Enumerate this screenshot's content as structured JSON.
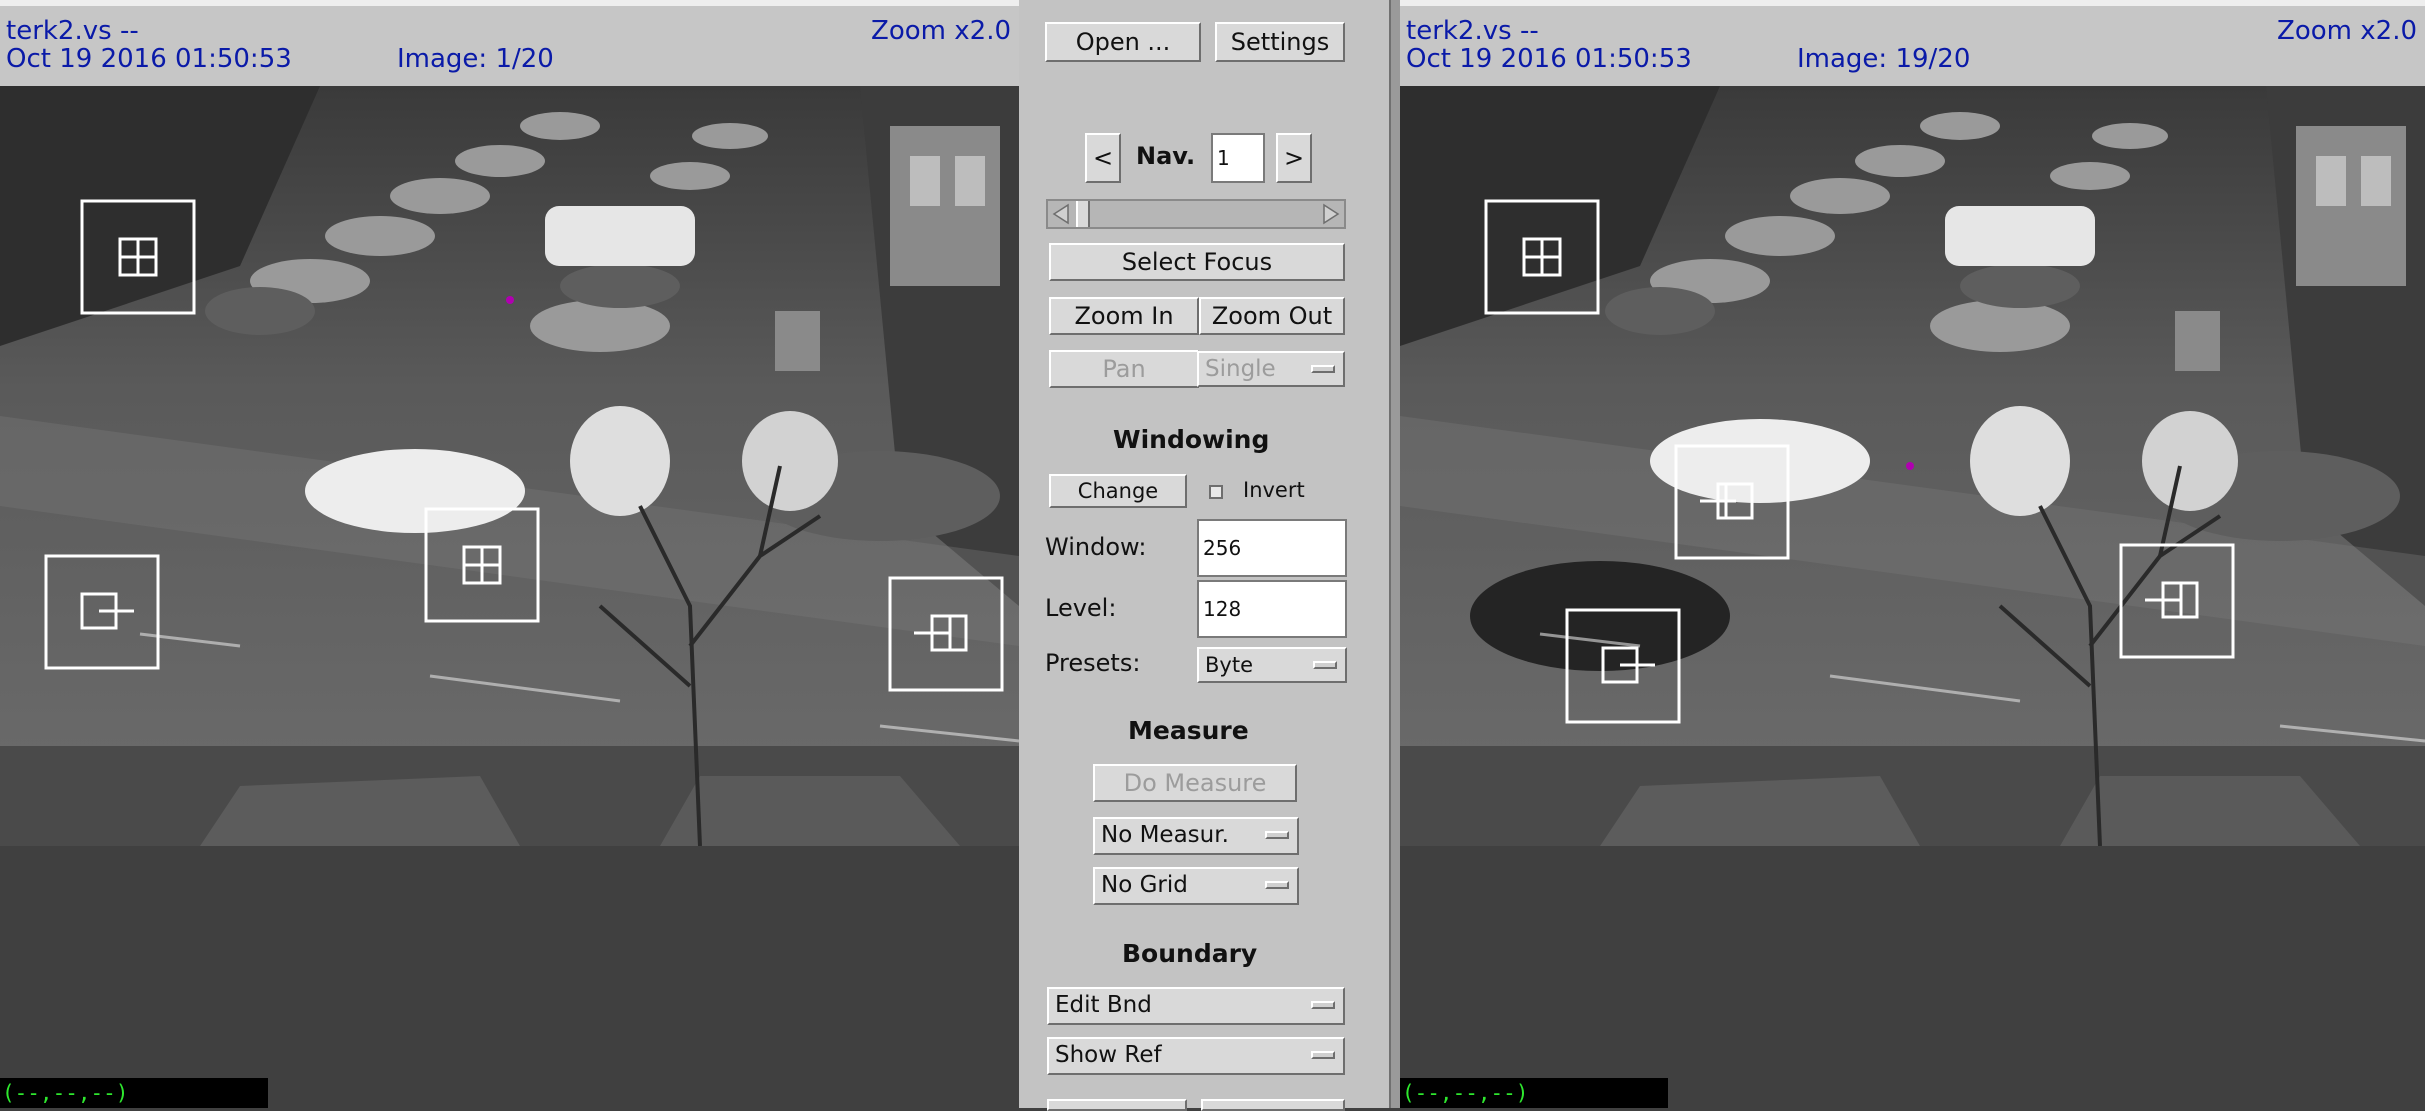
{
  "left_viewer": {
    "filename": "terk2.vs --",
    "datetime": "Oct 19 2016 01:50:53",
    "image_label": "Image: 1/20",
    "zoom_label": "Zoom x2.0",
    "coord_readout": "(--,--,--)"
  },
  "right_viewer": {
    "filename": "terk2.vs --",
    "datetime": "Oct 19 2016 01:50:53",
    "image_label": "Image: 19/20",
    "zoom_label": "Zoom x2.0",
    "coord_readout": "(--,--,--)"
  },
  "controls": {
    "open_label": "Open ...",
    "settings_label": "Settings",
    "nav_prev": "<",
    "nav_label": "Nav.",
    "nav_value": "1",
    "nav_next": ">",
    "select_focus_label": "Select Focus",
    "zoom_in_label": "Zoom  In",
    "zoom_out_label": "Zoom Out",
    "pan_label": "Pan",
    "pan_mode": "Single",
    "windowing_title": "Windowing",
    "change_label": "Change",
    "invert_label": "Invert",
    "window_label": "Window:",
    "window_value": "256",
    "level_label": "Level:",
    "level_value": "128",
    "presets_label": "Presets:",
    "presets_value": "Byte",
    "measure_title": "Measure",
    "do_measure_label": "Do Measure",
    "measure_mode": "No Measur.",
    "grid_mode": "No Grid",
    "boundary_title": "Boundary",
    "edit_bnd": "Edit Bnd",
    "show_ref": "Show Ref"
  },
  "icons": {
    "nav_prev": "chevron-left-icon",
    "nav_next": "chevron-right-icon",
    "dropdown": "dropdown-indicator-icon",
    "tracking_marker": "tracking-box-icon"
  },
  "colors": {
    "header_text": "#0a1aa8",
    "coord_text": "#2ee82e",
    "panel_bg": "#c3c3c3",
    "viewer_bg": "#404040"
  }
}
